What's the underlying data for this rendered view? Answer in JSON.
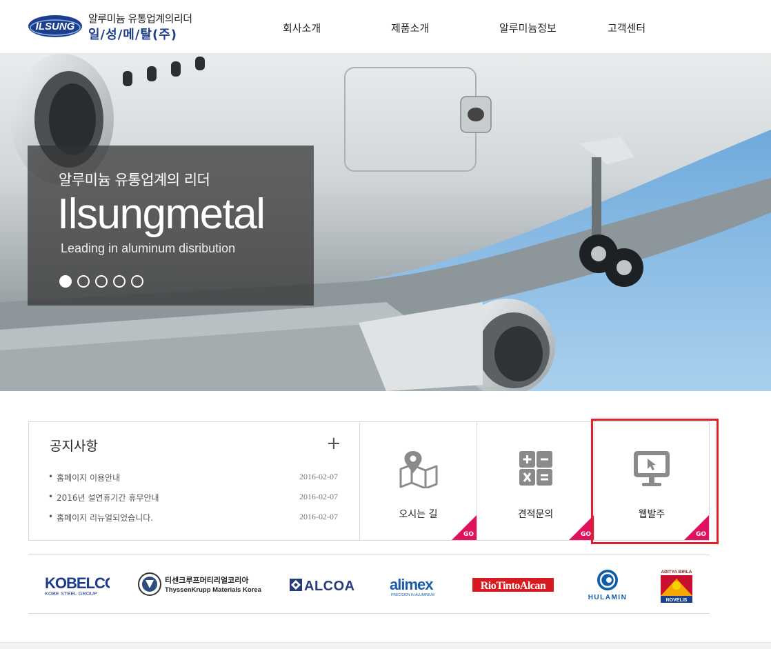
{
  "logo": {
    "mark": "ILSUNG",
    "tagline": "알루미늄 유통업계의리더",
    "company": "일/성/메/탈(주)"
  },
  "nav": {
    "items": [
      "회사소개",
      "제품소개",
      "알루미늄정보",
      "고객센터"
    ]
  },
  "hero": {
    "subtitle": "알루미늄 유통업계의 리더",
    "title": "Ilsungmetal",
    "tagline": "Leading in aluminum disribution",
    "slide_count": 5,
    "active_slide": 1
  },
  "notice": {
    "title": "공지사항",
    "more_icon": "plus-icon",
    "items": [
      {
        "bullet": "•",
        "text": "홈페이지 이용안내",
        "date": "2016-02-07"
      },
      {
        "bullet": "•",
        "text": "2016년 설연휴기간 휴무안내",
        "date": "2016-02-07"
      },
      {
        "bullet": "•",
        "text": "홈페이지 리뉴얼되었습니다.",
        "date": "2016-02-07"
      }
    ]
  },
  "quick_links": [
    {
      "label": "오시는 길",
      "icon": "map-pin-icon",
      "badge": "GO"
    },
    {
      "label": "견적문의",
      "icon": "calculator-icon",
      "badge": "GO"
    },
    {
      "label": "웹발주",
      "icon": "monitor-cursor-icon",
      "badge": "GO"
    }
  ],
  "partners": [
    {
      "name": "KOBELCO",
      "sub": "KOBE STEEL GROUP"
    },
    {
      "name": "티센크루프머티리얼코리아",
      "sub": "ThyssenKrupp Materials Korea"
    },
    {
      "name": "ALCOA",
      "sub": ""
    },
    {
      "name": "alimex",
      "sub": "PRECISION IN ALUMINIUM"
    },
    {
      "name": "RioTintoAlcan",
      "sub": ""
    },
    {
      "name": "HULAMIN",
      "sub": ""
    },
    {
      "name": "ADITYA BIRLA",
      "sub": "NOVELIS"
    }
  ],
  "colors": {
    "brand_blue": "#1b3f8c",
    "go_badge": "#e0115f",
    "highlight": "#e2202a"
  }
}
